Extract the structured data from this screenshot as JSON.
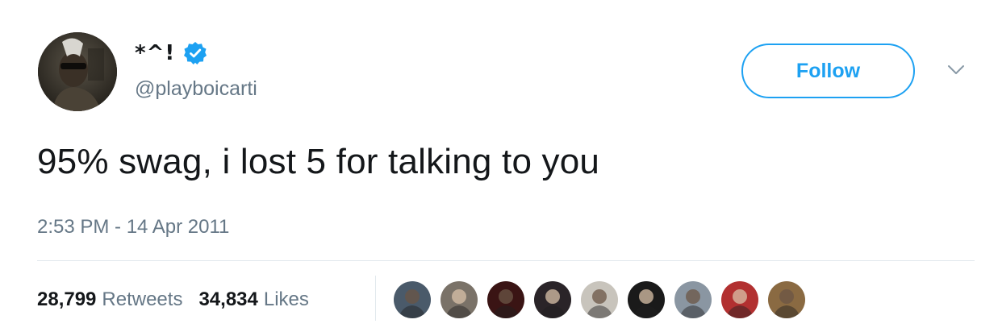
{
  "user": {
    "display_name": "*^!",
    "handle": "@playboicarti",
    "verified": true,
    "avatar_icon": "profile-photo"
  },
  "header": {
    "follow_label": "Follow",
    "caret_icon": "chevron-down-icon"
  },
  "tweet": {
    "text": "95% swag, i lost 5 for talking to you",
    "timestamp": "2:53 PM - 14 Apr 2011"
  },
  "stats": {
    "retweets_count": "28,799",
    "retweets_label": "Retweets",
    "likes_count": "34,834",
    "likes_label": "Likes"
  },
  "likers": [
    {
      "icon": "liker-avatar-1",
      "color": "#4a5a6a"
    },
    {
      "icon": "liker-avatar-2",
      "color": "#7a7268"
    },
    {
      "icon": "liker-avatar-3",
      "color": "#3a1414"
    },
    {
      "icon": "liker-avatar-4",
      "color": "#2a2428"
    },
    {
      "icon": "liker-avatar-5",
      "color": "#c8c4bc"
    },
    {
      "icon": "liker-avatar-6",
      "color": "#1a1a1a"
    },
    {
      "icon": "liker-avatar-7",
      "color": "#8a96a2"
    },
    {
      "icon": "liker-avatar-8",
      "color": "#b23030"
    },
    {
      "icon": "liker-avatar-9",
      "color": "#8a6a42"
    }
  ],
  "colors": {
    "accent": "#1da1f2",
    "text": "#14171a",
    "secondary": "#657786"
  }
}
